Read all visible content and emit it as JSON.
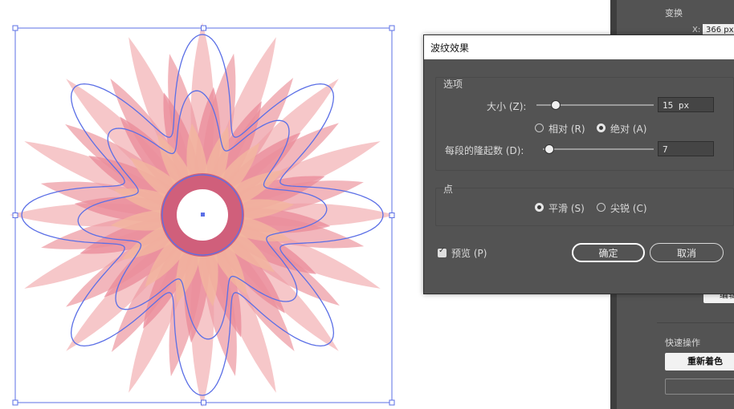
{
  "panel": {
    "section_transform": "变换",
    "x_label": "X:",
    "x_value": "366 px",
    "edit_label": "编辑",
    "section_quick": "快速操作",
    "recolor_label": "重新着色"
  },
  "dialog": {
    "title": "波纹效果",
    "options_legend": "选项",
    "size_label": "大小 (Z):",
    "size_value": "15 px",
    "relative_label": "相对 (R)",
    "absolute_label": "绝对 (A)",
    "ridges_label": "每段的隆起数 (D):",
    "ridges_value": "7",
    "points_legend": "点",
    "smooth_label": "平滑 (S)",
    "corner_label": "尖锐 (C)",
    "preview_label": "预览 (P)",
    "ok_label": "确定",
    "cancel_label": "取消",
    "size_mode": "absolute",
    "points_mode": "smooth",
    "preview_checked": true,
    "size_slider_fraction": 0.16,
    "ridges_slider_fraction": 0.05
  },
  "colors": {
    "path_stroke": "#5b6fe6",
    "petal": "#e98a98",
    "panel_bg": "#535353"
  }
}
